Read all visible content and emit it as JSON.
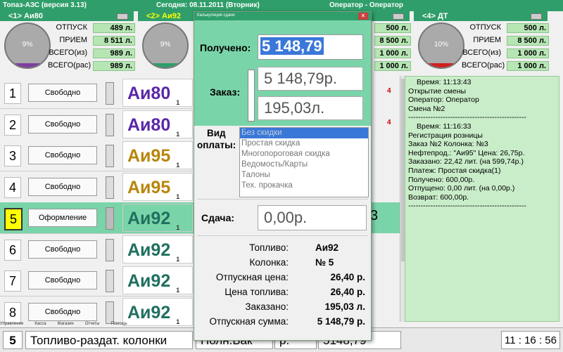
{
  "titlebar": {
    "app": "Топаз-АЗС  (версия 3.13)",
    "date": "Сегодня: 08.11.2011  (Вторник)",
    "operator": "Оператор - Оператор"
  },
  "tanks": [
    {
      "title": "<1> Аи80",
      "gauge_pct": "9%",
      "fill_fraction": 0.09,
      "fill_color": "#7b3fa0",
      "rows": [
        {
          "label": "ОТПУСК",
          "value": "489 л."
        },
        {
          "label": "ПРИЕМ",
          "value": "8 511 л."
        },
        {
          "label": "ВСЕГО(из)",
          "value": "989 л."
        },
        {
          "label": "ВСЕГО(рас)",
          "value": "989 л."
        }
      ]
    },
    {
      "title": "<2> Аи92",
      "gauge_pct": "9%",
      "fill_fraction": 0.09,
      "fill_color": "#2f9e6a",
      "rows": [
        {
          "label": "",
          "value": ""
        },
        {
          "label": "",
          "value": ""
        },
        {
          "label": "",
          "value": ""
        },
        {
          "label": "",
          "value": ""
        }
      ]
    },
    {
      "title": "",
      "gauge_pct": "",
      "fill_fraction": 0,
      "fill_color": "#2f9e6a",
      "rows": [
        {
          "label": "",
          "value": "500 л."
        },
        {
          "label": "",
          "value": "8 500 л."
        },
        {
          "label": "",
          "value": "1 000 л."
        },
        {
          "label": "",
          "value": "1 000 л."
        }
      ]
    },
    {
      "title": "<4> ДТ",
      "gauge_pct": "10%",
      "fill_fraction": 0.1,
      "fill_color": "#d02020",
      "rows": [
        {
          "label": "ОТПУСК",
          "value": "500 л."
        },
        {
          "label": "ПРИЕМ",
          "value": "8 500 л."
        },
        {
          "label": "ВСЕГО(из)",
          "value": "1 000 л."
        },
        {
          "label": "ВСЕГО(рас)",
          "value": "1 000 л."
        }
      ]
    }
  ],
  "pumps": [
    {
      "num": "1",
      "status": "Свободно",
      "fuel": "Аи80",
      "sub": "1",
      "right": "4"
    },
    {
      "num": "2",
      "status": "Свободно",
      "fuel": "Аи80",
      "sub": "1",
      "right": "4"
    },
    {
      "num": "3",
      "status": "Свободно",
      "fuel": "Аи95",
      "sub": "1",
      "right": ""
    },
    {
      "num": "4",
      "status": "Свободно",
      "fuel": "Аи95",
      "sub": "1",
      "right": ""
    },
    {
      "num": "5",
      "status": "Оформление",
      "fuel": "Аи92",
      "sub": "1",
      "right": "3"
    },
    {
      "num": "6",
      "status": "Свободно",
      "fuel": "Аи92",
      "sub": "1",
      "right": ""
    },
    {
      "num": "7",
      "status": "Свободно",
      "fuel": "Аи92",
      "sub": "1",
      "right": ""
    },
    {
      "num": "8",
      "status": "Свободно",
      "fuel": "Аи92",
      "sub": "1",
      "right": ""
    }
  ],
  "journal": [
    "Время: 11:13:43",
    "Открытие смены",
    "Оператор: Оператор",
    "Смена №2",
    "------------------------------------------------",
    "Время: 11:16:33",
    "Регистрация розницы",
    "Заказ №2   Колонка: №3",
    "Нефтепрод.: \"Аи95\"   Цена: 26,75р.",
    "Заказано: 22,42 лит. (на 599,74р.)",
    "Платеж: Простая скидка(1)",
    "Получено: 600,00р.",
    "Отпущено: 0,00 лит. (на 0,00р.)",
    "Возврат: 600,00р.",
    "------------------------------------------------"
  ],
  "menu": [
    "Управление",
    "Касса",
    "Магазин",
    "Отчеты",
    "Помощь"
  ],
  "statusbar": {
    "num": "5",
    "label": "Топливо-раздат. колонки",
    "mode": "Полн.Бак",
    "unit": "р.",
    "sum": "5148,79",
    "time": "11 : 16 : 56"
  },
  "dialog": {
    "title": "Калькуляция сдачи",
    "close": "✕",
    "received_label": "Получено:",
    "received_value": "5 148,79",
    "order_label": "Заказ:",
    "order_sum": "5 148,79р.",
    "order_liters": "195,03л.",
    "payment_label_1": "Вид",
    "payment_label_2": "оплаты:",
    "payment_options": [
      "Без скидки",
      "Простая скидка",
      "Многопороговая скидка",
      "Ведомость/Карты",
      "Талоны",
      "Тех. прокачка"
    ],
    "change_label": "Сдача:",
    "change_value": "0,00р.",
    "info": [
      {
        "label": "Топливо:",
        "value": "Аи92"
      },
      {
        "label": "Колонка:",
        "value": "№ 5"
      },
      {
        "label": "Отпускная цена:",
        "value": "26,40 р."
      },
      {
        "label": "Цена топлива:",
        "value": "26,40 р."
      },
      {
        "label": "Заказано:",
        "value": "195,03 л."
      },
      {
        "label": "Отпускная сумма:",
        "value": "5 148,79 р."
      }
    ]
  }
}
